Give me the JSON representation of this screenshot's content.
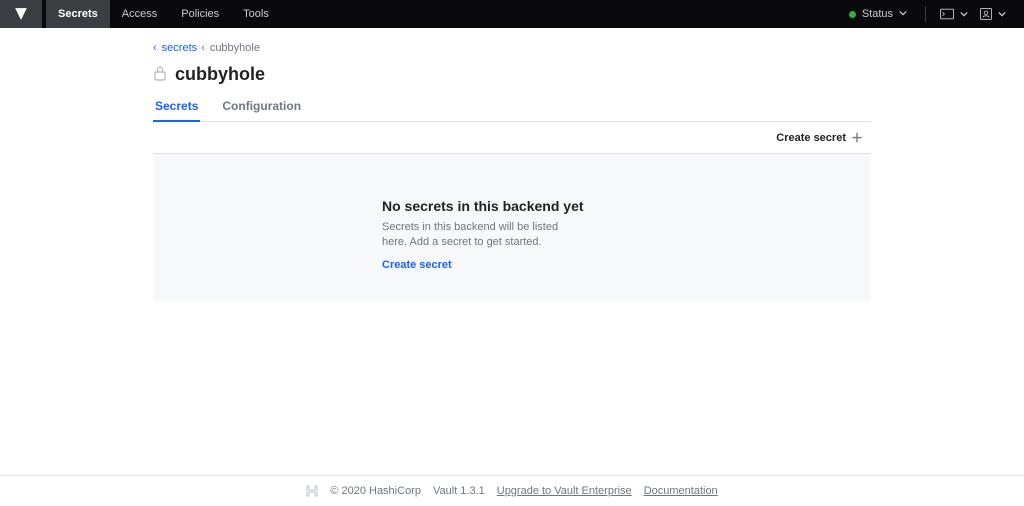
{
  "nav": {
    "items": [
      {
        "label": "Secrets",
        "active": true
      },
      {
        "label": "Access",
        "active": false
      },
      {
        "label": "Policies",
        "active": false
      },
      {
        "label": "Tools",
        "active": false
      }
    ],
    "status_label": "Status"
  },
  "breadcrumb": {
    "parent": "secrets",
    "current": "cubbyhole"
  },
  "page_title": "cubbyhole",
  "tabs": [
    {
      "label": "Secrets",
      "active": true
    },
    {
      "label": "Configuration",
      "active": false
    }
  ],
  "toolbar": {
    "create_secret_label": "Create secret"
  },
  "empty": {
    "title": "No secrets in this backend yet",
    "message": "Secrets in this backend will be listed here. Add a secret to get started.",
    "cta": "Create secret"
  },
  "footer": {
    "copyright": "© 2020 HashiCorp",
    "version": "Vault 1.3.1",
    "upgrade": "Upgrade to Vault Enterprise",
    "docs": "Documentation"
  },
  "colors": {
    "accent": "#1563ff",
    "status_ok": "#2eb039"
  }
}
